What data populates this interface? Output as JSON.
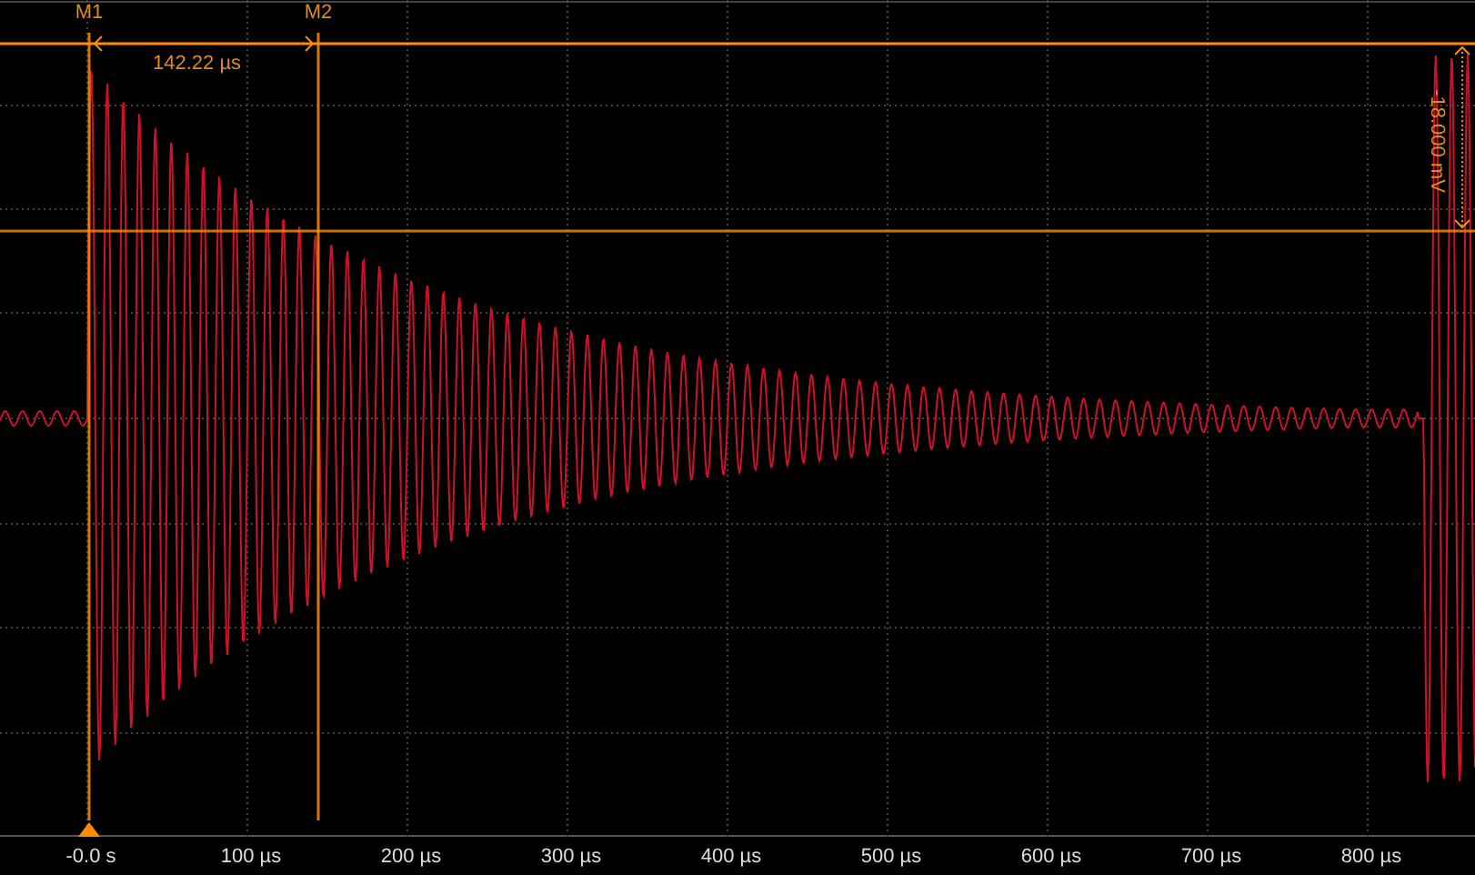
{
  "markers": [
    {
      "label": "M1"
    },
    {
      "label": "M2"
    }
  ],
  "time_delta": "142.22 µs",
  "voltage_delta": "-18.000 mV",
  "x_axis": {
    "labels": [
      "-0.0 s",
      "100 µs",
      "200 µs",
      "300 µs",
      "400 µs",
      "500 µs",
      "600 µs",
      "700 µs",
      "800 µs"
    ]
  }
}
